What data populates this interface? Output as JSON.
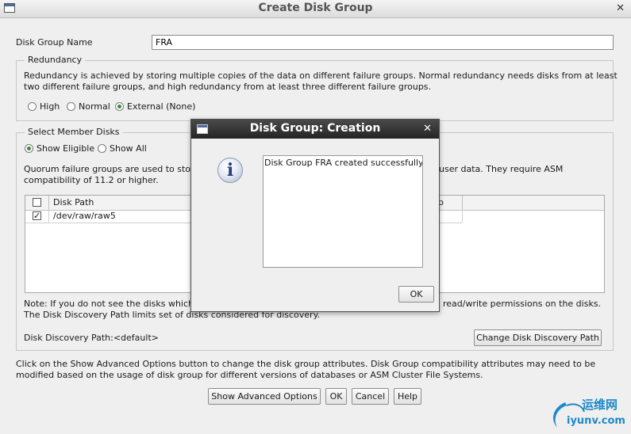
{
  "window": {
    "title": "Create Disk Group"
  },
  "disk_group_name": {
    "label": "Disk Group Name",
    "value": "FRA"
  },
  "redundancy": {
    "legend": "Redundancy",
    "description_line1": "Redundancy is achieved by storing multiple copies of the data on different failure groups. Normal redundancy needs disks from at least",
    "description_line2": "two different failure groups, and high redundancy from at least three different failure groups.",
    "options": [
      {
        "label": "High",
        "selected": false
      },
      {
        "label": "Normal",
        "selected": false
      },
      {
        "label": "External (None)",
        "selected": true
      }
    ]
  },
  "member_disks": {
    "legend": "Select Member Disks",
    "filters": [
      {
        "label": "Show Eligible",
        "selected": true
      },
      {
        "label": "Show All",
        "selected": false
      }
    ],
    "quorum_line1_start": "Quorum failure groups are used to stor",
    "quorum_line1_end": "user data. They require ASM",
    "quorum_line2": "compatibility of 11.2 or higher.",
    "table": {
      "header_path": "Disk Path",
      "header_trail": "p",
      "rows": [
        {
          "checked": true,
          "path": "/dev/raw/raw5"
        }
      ]
    },
    "note_line1_start": "Note: If you do not see the disks which",
    "note_line1_end": "read/write permissions on the disks.",
    "note_line2": "The Disk Discovery Path limits set of disks considered for discovery.",
    "discovery_path": "Disk Discovery Path:<default>",
    "change_path_button": "Change Disk Discovery Path"
  },
  "footer_line1": "Click on the Show Advanced Options button to change the disk group attributes. Disk Group compatibility attributes may need to be",
  "footer_line2": "modified based on the usage of disk group for different versions of databases or ASM Cluster File Systems.",
  "buttons": {
    "advanced": "Show Advanced Options",
    "ok": "OK",
    "cancel": "Cancel",
    "help": "Help"
  },
  "dialog": {
    "title": "Disk Group: Creation",
    "message": "Disk Group FRA created successfully.",
    "ok": "OK",
    "icon": "information-icon"
  },
  "watermark": {
    "text": "运维网",
    "url_text": "iyunv.com"
  },
  "colors": {
    "modal_titlebar": "#2e2e2e",
    "radio_selected": "#3a8a3a",
    "watermark": "#1e88c8"
  }
}
